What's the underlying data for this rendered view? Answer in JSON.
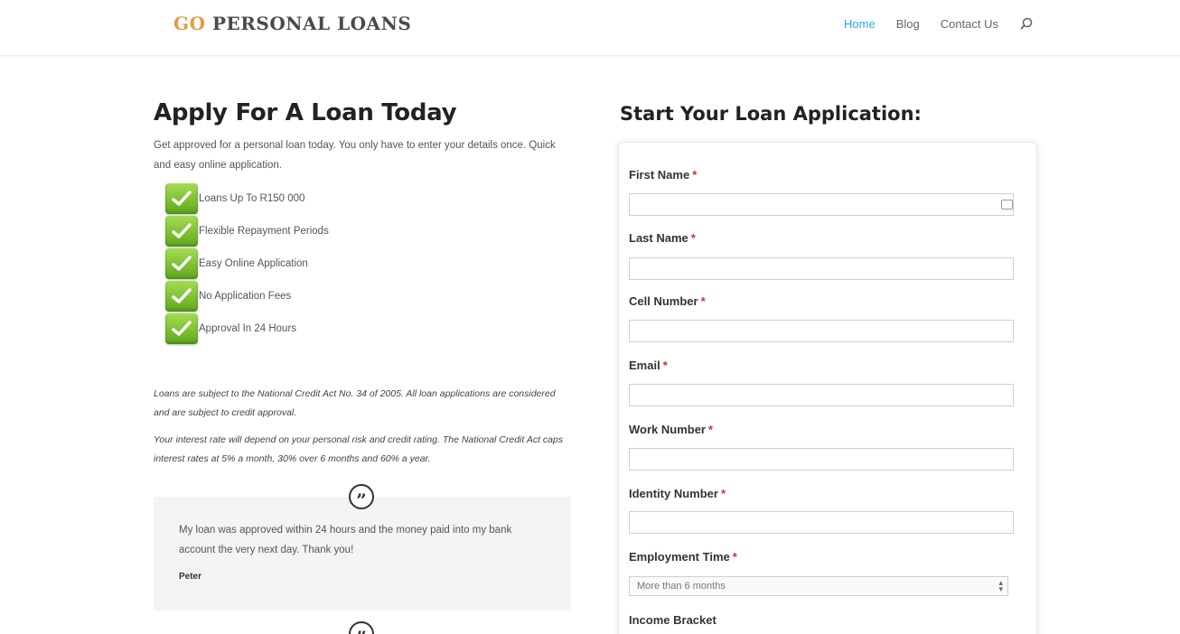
{
  "header": {
    "logo_go": "GO",
    "logo_rest": " PERSONAL LOANS",
    "nav": [
      {
        "label": "Home"
      },
      {
        "label": "Blog"
      },
      {
        "label": "Contact Us"
      }
    ]
  },
  "left": {
    "title": "Apply For A Loan Today",
    "intro": "Get approved for a personal loan today. You only have to enter your details once. Quick and easy online application.",
    "benefits": [
      "Loans Up To R150 000",
      "Flexible Repayment Periods",
      "Easy Online Application",
      "No Application Fees",
      "Approval In 24 Hours"
    ],
    "disclaimer_1": "Loans are subject to the National Credit Act No. 34 of 2005. All loan applications are considered and are subject to credit approval.",
    "disclaimer_2": "Your interest rate will depend on your personal risk and credit rating. The National Credit Act caps interest rates at 5% a month, 30% over 6 months and 60% a year.",
    "testimonial": {
      "quote": "My loan was approved within 24 hours and the money paid into my bank account the very next day. Thank you!",
      "author": "Peter"
    }
  },
  "form": {
    "title": "Start Your Loan Application:",
    "required_mark": "*",
    "fields": [
      {
        "label": "First Name",
        "value": ""
      },
      {
        "label": "Last Name",
        "value": ""
      },
      {
        "label": "Cell Number",
        "value": ""
      },
      {
        "label": "Email",
        "value": ""
      },
      {
        "label": "Work Number",
        "value": ""
      },
      {
        "label": "Identity Number",
        "value": ""
      }
    ],
    "employment_time": {
      "label": "Employment Time",
      "selected": "More than 6 months"
    },
    "income_bracket": {
      "label": "Income Bracket"
    }
  },
  "colors": {
    "accent": "#2ea3f2",
    "logo_orange": "#e79a3f",
    "check_green": "#7cc23a",
    "required_red": "#c0392b"
  },
  "icons": [
    "search-icon",
    "check-icon",
    "quote-icon",
    "autofill-icon",
    "select-arrows-icon"
  ]
}
